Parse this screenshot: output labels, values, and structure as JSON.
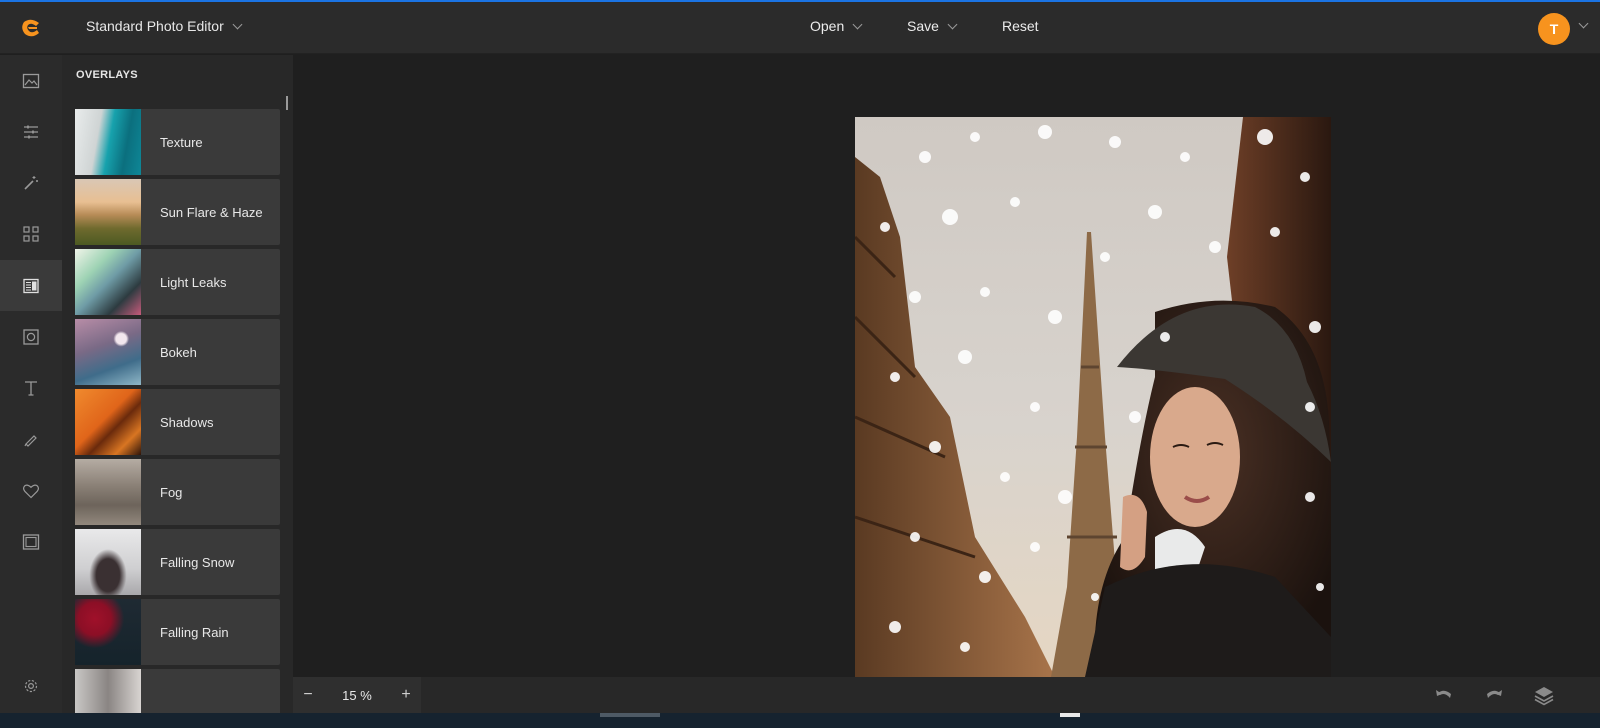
{
  "header": {
    "app_title": "Standard Photo Editor",
    "menus": [
      {
        "label": "Open"
      },
      {
        "label": "Save"
      },
      {
        "label": "Reset"
      }
    ],
    "avatar_initial": "T"
  },
  "sidebar": {
    "tools": [
      {
        "name": "image-icon"
      },
      {
        "name": "adjust-sliders-icon"
      },
      {
        "name": "magic-wand-icon"
      },
      {
        "name": "effects-grid-icon"
      },
      {
        "name": "overlays-icon",
        "active": true
      },
      {
        "name": "frame-icon"
      },
      {
        "name": "text-icon"
      },
      {
        "name": "brush-icon"
      },
      {
        "name": "heart-icon"
      },
      {
        "name": "border-icon"
      },
      {
        "name": "settings-icon"
      }
    ]
  },
  "panel": {
    "title": "OVERLAYS",
    "items": [
      {
        "label": "Texture"
      },
      {
        "label": "Sun Flare & Haze"
      },
      {
        "label": "Light Leaks"
      },
      {
        "label": "Bokeh"
      },
      {
        "label": "Shadows"
      },
      {
        "label": "Fog"
      },
      {
        "label": "Falling Snow"
      },
      {
        "label": "Falling Rain"
      },
      {
        "label": ""
      }
    ]
  },
  "footer": {
    "zoom_minus": "−",
    "zoom_value": "15 %",
    "zoom_plus": "+"
  },
  "colors": {
    "accent": "#f7931e",
    "topline": "#1b74e4"
  }
}
